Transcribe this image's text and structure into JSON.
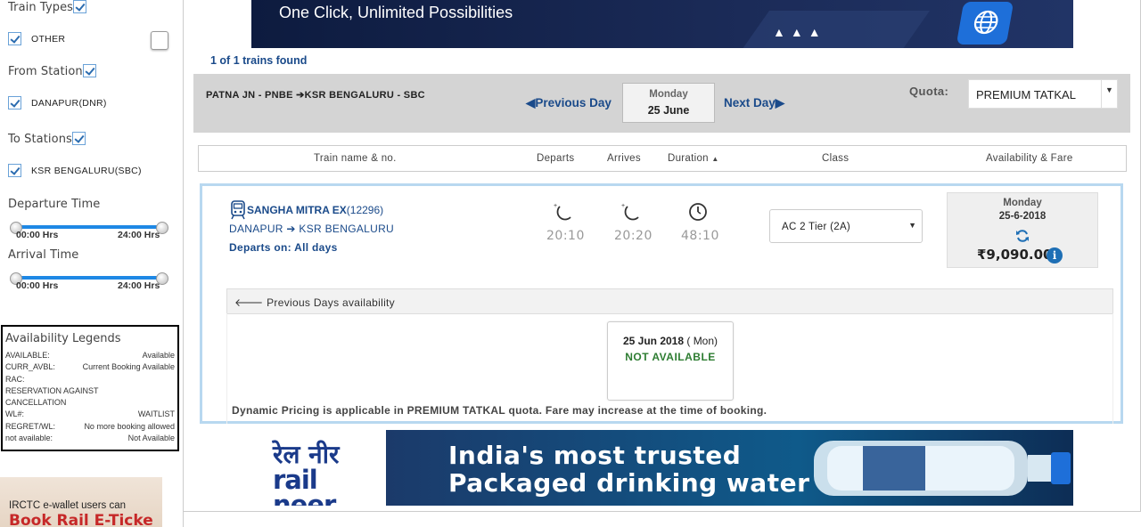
{
  "sidebar": {
    "train_types": {
      "heading": "Train Types",
      "items": [
        {
          "label": "OTHER"
        }
      ]
    },
    "from_stations": {
      "heading": "From Stations",
      "items": [
        {
          "label": "DANAPUR(DNR)"
        }
      ]
    },
    "to_stations": {
      "heading": "To Stations",
      "items": [
        {
          "label": "KSR BENGALURU(SBC)"
        }
      ]
    },
    "departure_time": {
      "heading": "Departure Time",
      "min_label": "00:00 Hrs",
      "max_label": "24:00 Hrs"
    },
    "arrival_time": {
      "heading": "Arrival Time",
      "min_label": "00:00 Hrs",
      "max_label": "24:00 Hrs"
    },
    "legend": {
      "title": "Availability Legends",
      "rows": [
        {
          "key": "AVAILABLE:",
          "value": "Available"
        },
        {
          "key": "CURR_AVBL:",
          "value": "Current Booking Available"
        },
        {
          "key": "RAC:",
          "value": ""
        },
        {
          "key": "RESERVATION AGAINST CANCELLATION",
          "value": ""
        },
        {
          "key": "WL#:",
          "value": "WAITLIST"
        },
        {
          "key": "REGRET/WL:",
          "value": "No more booking allowed"
        },
        {
          "key": "not available:",
          "value": "Not Available"
        }
      ]
    },
    "ewallet_ad": {
      "line1": "IRCTC e-wallet users can",
      "line2": "Book Rail E-Ticke"
    }
  },
  "top_banner": {
    "text": "One Click, Unlimited Possibilities"
  },
  "results": {
    "found_text": "1 of 1 trains found",
    "route": "PATNA JN - PNBE ➔KSR BENGALURU - SBC",
    "prev_day": "Previous Day",
    "next_day": "Next Day",
    "date_day": "Monday",
    "date_value": "25 June",
    "quota_label": "Quota:",
    "quota_value": "PREMIUM TATKAL"
  },
  "columns": {
    "train": "Train name & no.",
    "departs": "Departs",
    "arrives": "Arrives",
    "duration": "Duration",
    "class": "Class",
    "availability": "Availability & Fare"
  },
  "train": {
    "name": "SANGHA MITRA EX",
    "number": "(12296)",
    "from": "DANAPUR",
    "to": "KSR BENGALURU",
    "departs_on": "Departs on: All days",
    "departs_time": "20:10",
    "arrives_time": "20:20",
    "duration": "48:10",
    "class_selected": "AC 2 Tier (2A)",
    "fare_day": "Monday",
    "fare_date": "25-6-2018",
    "fare": "₹9,090.00",
    "prev_days_label": "Previous Days availability",
    "avail_date": "25 Jun 2018",
    "avail_weekday": "( Mon)",
    "avail_status": "NOT AVAILABLE",
    "dynamic_note": "Dynamic Pricing is applicable in PREMIUM TATKAL quota. Fare may increase at the time of booking."
  },
  "railneer_ad": {
    "logo_hi": "रेल नीर",
    "logo_en": "rail neer",
    "line1": "India's most trusted",
    "line2": "Packaged drinking water"
  },
  "colors": {
    "accent": "#1a4a8a",
    "status_unavailable": "#2e7d32",
    "slider": "#1e88e5"
  }
}
